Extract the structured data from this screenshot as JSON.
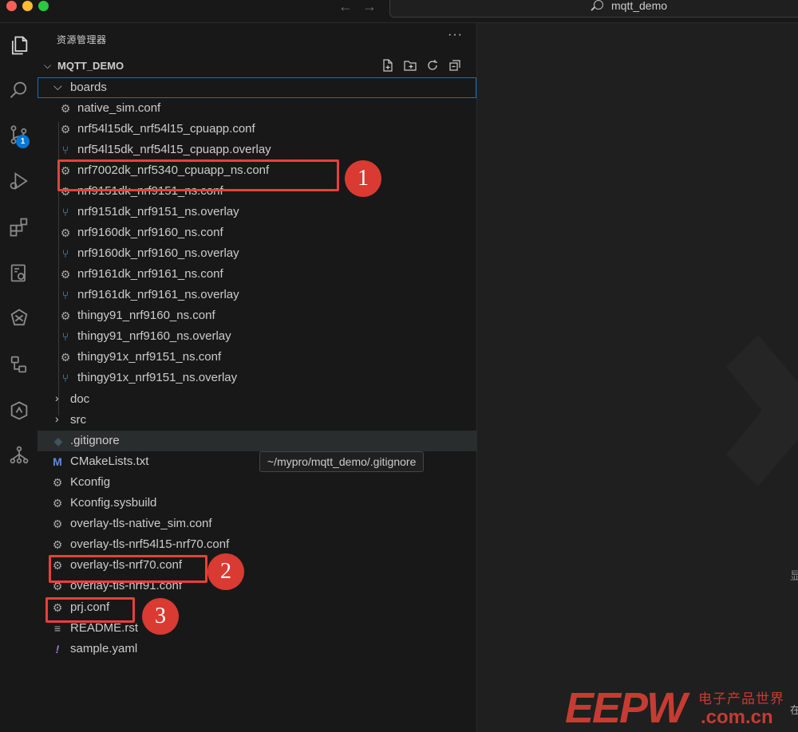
{
  "titlebar": {
    "search_text": "mqtt_demo",
    "nav_back": "←",
    "nav_forward": "→"
  },
  "activity_bar": {
    "items": [
      {
        "name": "explorer-icon"
      },
      {
        "name": "search-icon"
      },
      {
        "name": "source-control-icon",
        "badge": "1"
      },
      {
        "name": "run-debug-icon"
      },
      {
        "name": "extensions-icon"
      },
      {
        "name": "remote-explorer-icon"
      },
      {
        "name": "nordic-connect-icon"
      },
      {
        "name": "device-tree-icon"
      },
      {
        "name": "devicetree-visual-icon"
      },
      {
        "name": "dependency-icon"
      }
    ]
  },
  "sidebar": {
    "title": "资源管理器",
    "more": "···",
    "section": {
      "name": "MQTT_DEMO",
      "actions": [
        "new-file-icon",
        "new-folder-icon",
        "refresh-icon",
        "collapse-all-icon"
      ]
    },
    "tree": [
      {
        "label": "boards",
        "type": "folder-open",
        "depth": 1
      },
      {
        "label": "native_sim.conf",
        "type": "conf",
        "depth": 2
      },
      {
        "label": "nrf54l15dk_nrf54l15_cpuapp.conf",
        "type": "conf",
        "depth": 2
      },
      {
        "label": "nrf54l15dk_nrf54l15_cpuapp.overlay",
        "type": "overlay",
        "depth": 2
      },
      {
        "label": "nrf7002dk_nrf5340_cpuapp_ns.conf",
        "type": "conf",
        "depth": 2
      },
      {
        "label": "nrf9151dk_nrf9151_ns.conf",
        "type": "conf",
        "depth": 2
      },
      {
        "label": "nrf9151dk_nrf9151_ns.overlay",
        "type": "overlay",
        "depth": 2
      },
      {
        "label": "nrf9160dk_nrf9160_ns.conf",
        "type": "conf",
        "depth": 2
      },
      {
        "label": "nrf9160dk_nrf9160_ns.overlay",
        "type": "overlay",
        "depth": 2
      },
      {
        "label": "nrf9161dk_nrf9161_ns.conf",
        "type": "conf",
        "depth": 2
      },
      {
        "label": "nrf9161dk_nrf9161_ns.overlay",
        "type": "overlay",
        "depth": 2
      },
      {
        "label": "thingy91_nrf9160_ns.conf",
        "type": "conf",
        "depth": 2
      },
      {
        "label": "thingy91_nrf9160_ns.overlay",
        "type": "overlay",
        "depth": 2
      },
      {
        "label": "thingy91x_nrf9151_ns.conf",
        "type": "conf",
        "depth": 2
      },
      {
        "label": "thingy91x_nrf9151_ns.overlay",
        "type": "overlay",
        "depth": 2
      },
      {
        "label": "doc",
        "type": "folder",
        "depth": 1
      },
      {
        "label": "src",
        "type": "folder",
        "depth": 1
      },
      {
        "label": ".gitignore",
        "type": "git",
        "depth": 1
      },
      {
        "label": "CMakeLists.txt",
        "type": "cmake",
        "depth": 1
      },
      {
        "label": "Kconfig",
        "type": "kconfig",
        "depth": 1
      },
      {
        "label": "Kconfig.sysbuild",
        "type": "kconfig",
        "depth": 1
      },
      {
        "label": "overlay-tls-native_sim.conf",
        "type": "conf",
        "depth": 1
      },
      {
        "label": "overlay-tls-nrf54l15-nrf70.conf",
        "type": "conf",
        "depth": 1
      },
      {
        "label": "overlay-tls-nrf70.conf",
        "type": "conf",
        "depth": 1
      },
      {
        "label": "overlay-tls-nrf91.conf",
        "type": "conf",
        "depth": 1
      },
      {
        "label": "prj.conf",
        "type": "conf",
        "depth": 1
      },
      {
        "label": "README.rst",
        "type": "readme",
        "depth": 1
      },
      {
        "label": "sample.yaml",
        "type": "yaml",
        "depth": 1
      }
    ],
    "tooltip": "~/mypro/mqtt_demo/.gitignore"
  },
  "annotations": [
    "1",
    "2",
    "3"
  ],
  "editor": {
    "side_text": "显",
    "side_text2": "在"
  },
  "watermark": {
    "logo": "EEPW",
    "cn": "电子产品世界",
    "com": ".com.cn"
  }
}
